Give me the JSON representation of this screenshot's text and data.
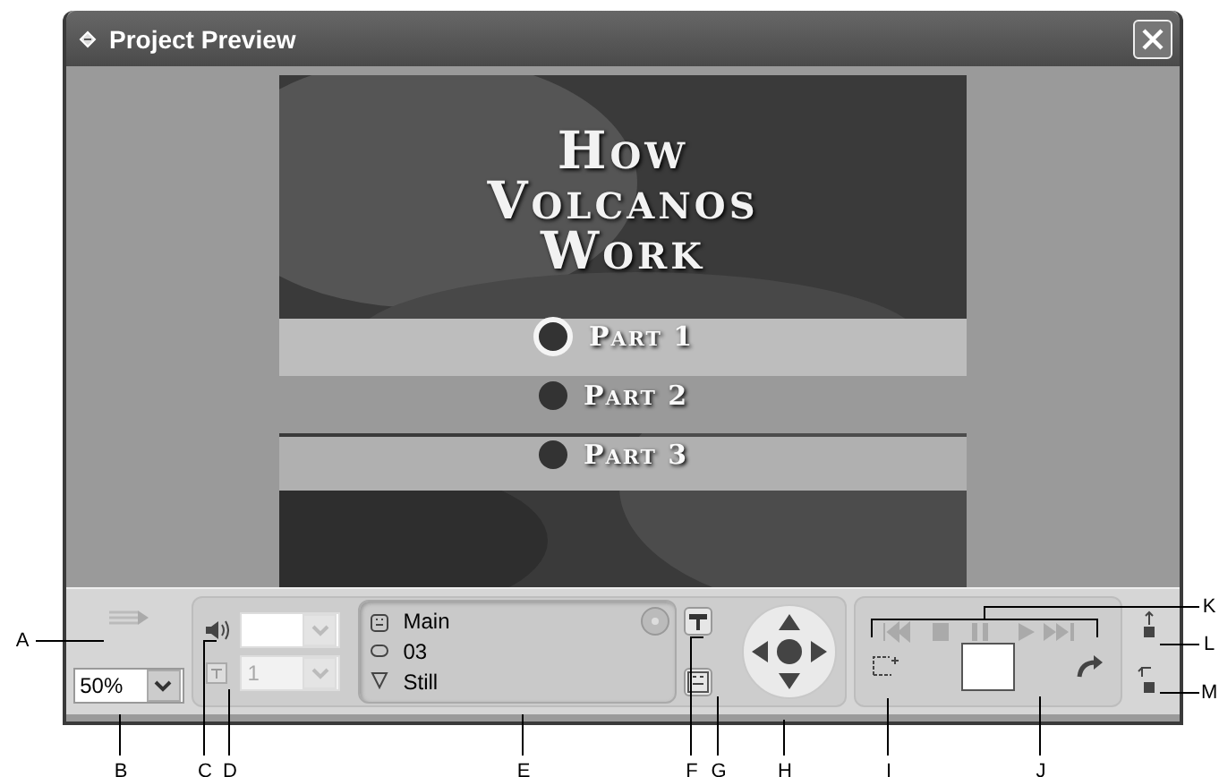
{
  "window": {
    "title": "Project Preview"
  },
  "menu_preview": {
    "title_lines": [
      "How",
      "Volcanos",
      "Work"
    ],
    "buttons": [
      {
        "label": "Part 1",
        "selected": true
      },
      {
        "label": "Part 2",
        "selected": false
      },
      {
        "label": "Part 3",
        "selected": false
      }
    ]
  },
  "controls": {
    "zoom": {
      "value": "50%"
    },
    "subtitle_track": {
      "value": "1",
      "disabled": true
    },
    "info": [
      "Main",
      "03",
      "Still"
    ]
  },
  "callouts": [
    "A",
    "B",
    "C",
    "D",
    "E",
    "F",
    "G",
    "H",
    "I",
    "J",
    "K",
    "L",
    "M"
  ]
}
